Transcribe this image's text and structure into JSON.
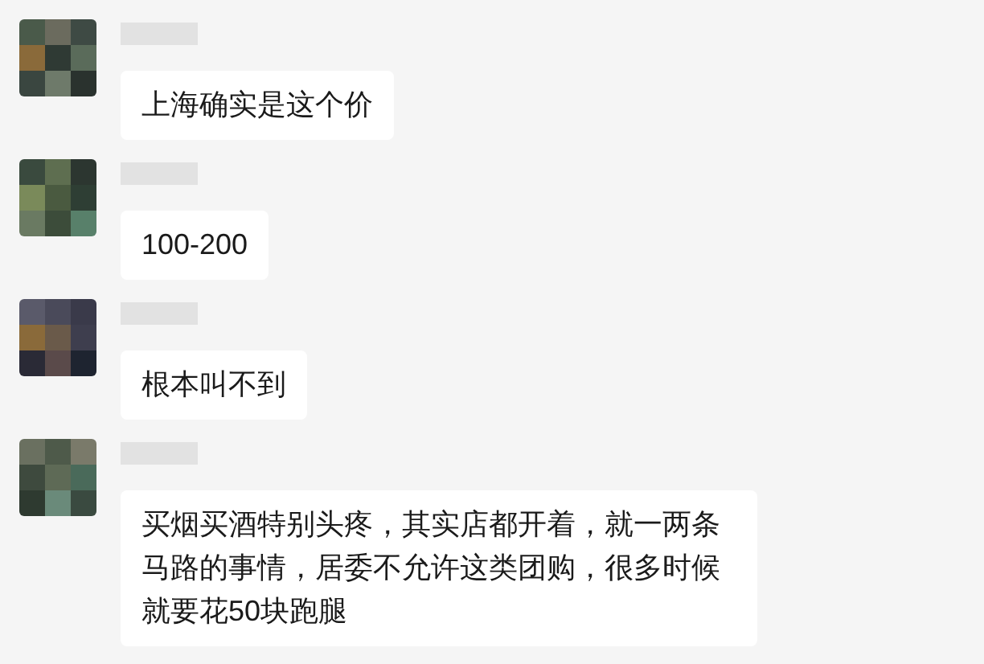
{
  "messages": [
    {
      "text": "上海确实是这个价"
    },
    {
      "text": "100-200"
    },
    {
      "text": "根本叫不到"
    },
    {
      "text": "买烟买酒特别头疼，其实店都开着，就一两条马路的事情，居委不允许这类团购，很多时候就要花50块跑腿"
    }
  ]
}
